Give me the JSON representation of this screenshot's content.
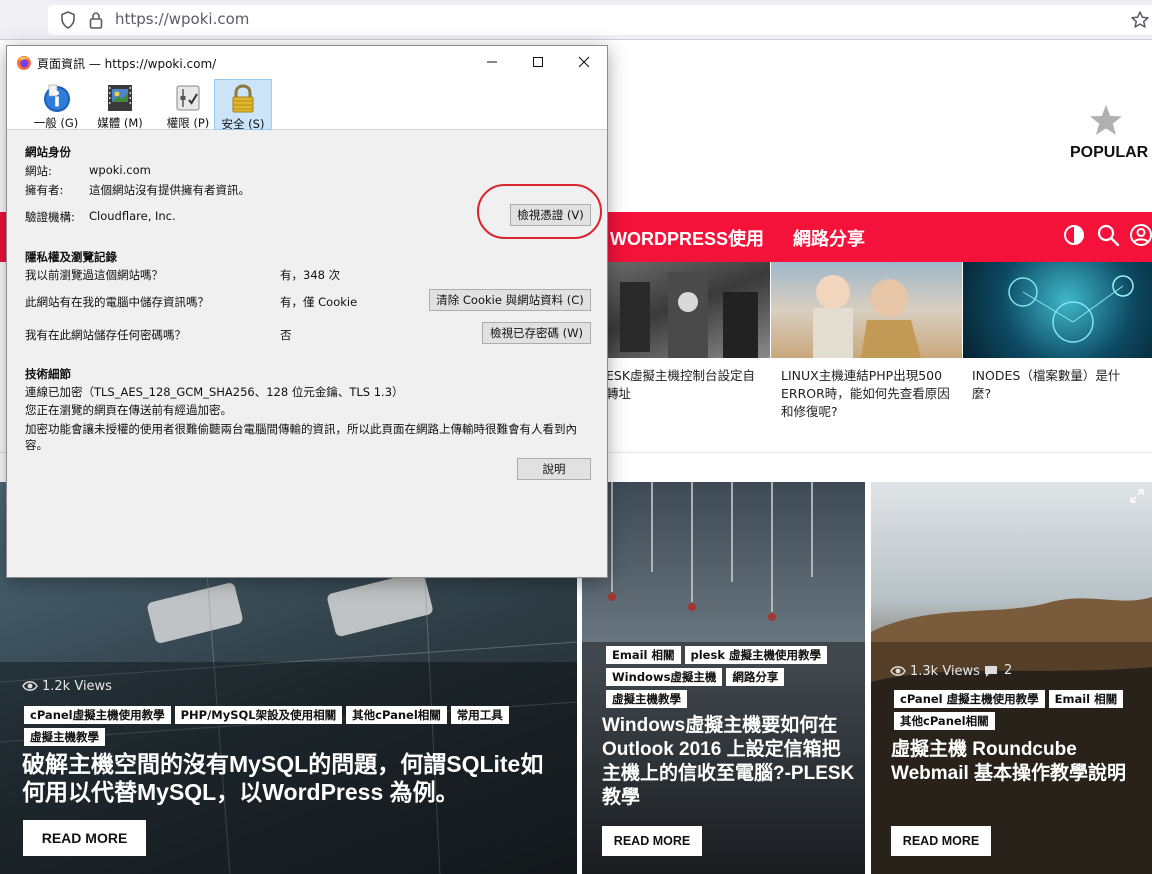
{
  "browser": {
    "url": "https://wpoki.com"
  },
  "site": {
    "popular_label": "POPULAR",
    "nav": [
      "WORDPRESS使用",
      "網路分享"
    ],
    "thumbs": [
      {
        "title": "ESK虛擬主機控制台設定自\n轉址"
      },
      {
        "title": "LINUX主機連結PHP出現500\nERROR時，能如何先查看原因\n和修復呢?"
      },
      {
        "title": "INODES（檔案數量）是什\n麼?"
      }
    ],
    "cards": [
      {
        "views": "1.2k Views",
        "tags": [
          "cPanel虛擬主機使用教學",
          "PHP/MySQL架設及使用相關",
          "其他cPanel相關",
          "常用工具",
          "虛擬主機教學"
        ],
        "title": "破解主機空間的沒有MySQL的問題，何謂SQLite如何用以代替MySQL，以WordPress 為例。",
        "read_more": "READ MORE"
      },
      {
        "views": "",
        "tags": [
          "Email 相關",
          "plesk 虛擬主機使用教學",
          "Windows虛擬主機",
          "網路分享",
          "虛擬主機教學"
        ],
        "title": "Windows虛擬主機要如何在 Outlook 2016 上設定信箱把主機上的信收至電腦?-PLESK教學",
        "read_more": "READ MORE"
      },
      {
        "views": "1.3k Views",
        "comments": "2",
        "tags": [
          "cPanel 虛擬主機使用教學",
          "Email 相關",
          "其他cPanel相關"
        ],
        "title": "虛擬主機 Roundcube Webmail 基本操作教學說明",
        "read_more": "READ MORE"
      }
    ]
  },
  "dialog": {
    "title": "頁面資訊 — https://wpoki.com/",
    "tabs": [
      {
        "label": "一般 (G)"
      },
      {
        "label": "媒體 (M)"
      },
      {
        "label": "權限 (P)"
      },
      {
        "label": "安全 (S)"
      }
    ],
    "identity": {
      "heading": "網站身份",
      "site_label": "網站:",
      "site_value": "wpoki.com",
      "owner_label": "擁有者:",
      "owner_value": "這個網站沒有提供擁有者資訊。",
      "verifier_label": "驗證機構:",
      "verifier_value": "Cloudflare, Inc.",
      "view_cert_button": "檢視憑證 (V)"
    },
    "privacy": {
      "heading": "隱私權及瀏覽記錄",
      "q1": "我以前瀏覽過這個網站嗎？",
      "a1": "有，348 次",
      "q2": "此網站有在我的電腦中儲存資訊嗎？",
      "a2": "有，僅 Cookie",
      "clear_button": "清除 Cookie 與網站資料 (C)",
      "q3": "我有在此網站儲存任何密碼嗎？",
      "a3": "否",
      "view_passwords_button": "檢視已存密碼 (W)"
    },
    "technical": {
      "heading": "技術細節",
      "line1": "連線已加密（TLS_AES_128_GCM_SHA256、128 位元金鑰、TLS 1.3）",
      "line2": "您正在瀏覽的網頁在傳送前有經過加密。",
      "line3": "加密功能會讓未授權的使用者很難偷聽兩台電腦間傳輸的資訊，所以此頁面在網路上傳輸時很難會有人看到內容。",
      "help_button": "說明"
    }
  },
  "colors": {
    "brand_red": "#f4123b",
    "highlight_ring": "#d9242c",
    "active_tab": "#cce4f7"
  }
}
